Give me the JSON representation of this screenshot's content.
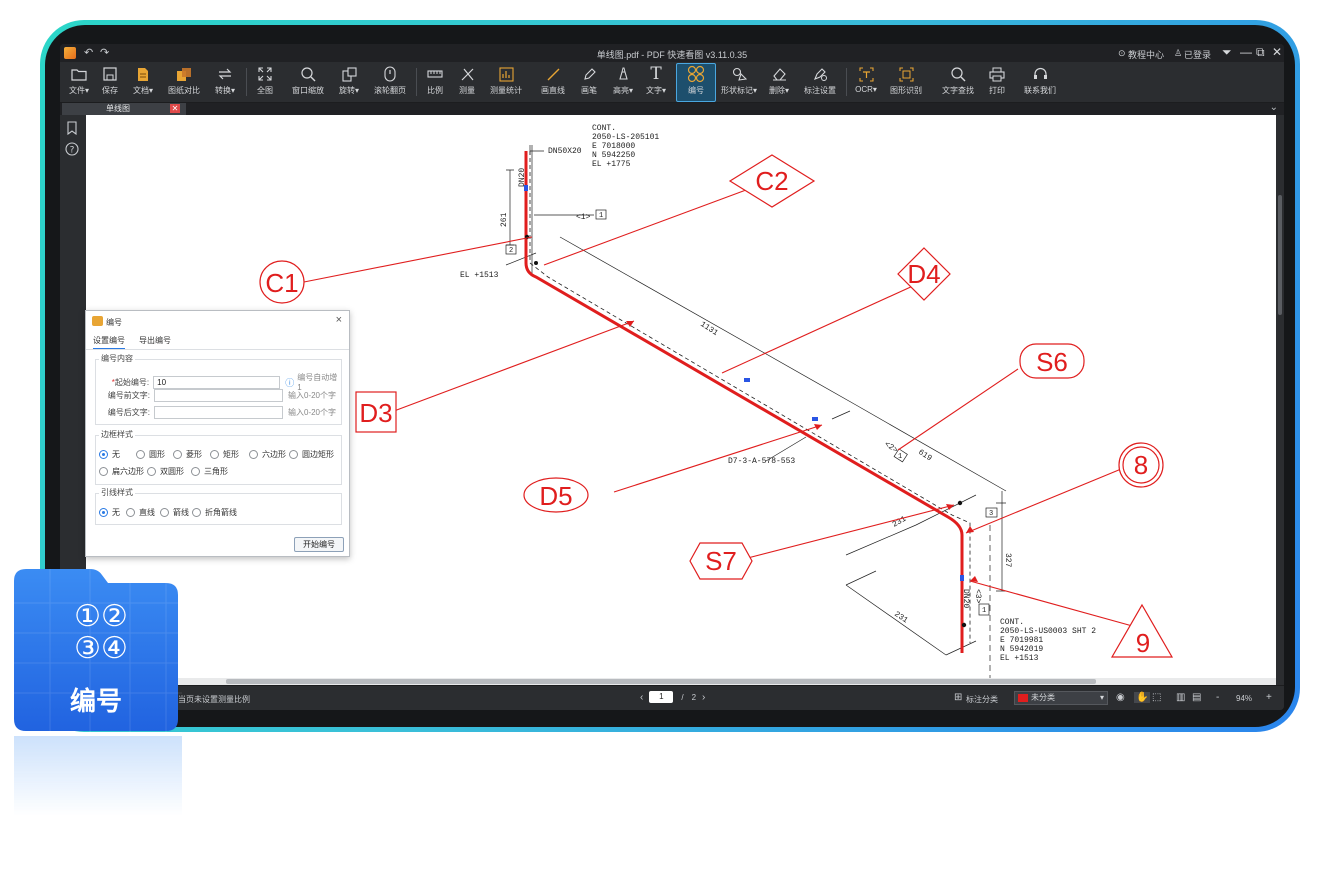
{
  "window": {
    "title": "单线图.pdf - PDF 快速看图 v3.11.0.35",
    "help_center": "教程中心",
    "login_status": "已登录"
  },
  "toolbar": {
    "items": [
      {
        "icon": "folder-icon",
        "label": "文件▾"
      },
      {
        "icon": "save-icon",
        "label": "保存"
      },
      {
        "icon": "document-icon",
        "label": "文档▾"
      },
      {
        "icon": "compare-icon",
        "label": "图纸对比"
      },
      {
        "icon": "convert-icon",
        "label": "转换▾"
      },
      {
        "icon": "fit-all-icon",
        "label": "全图"
      },
      {
        "icon": "zoom-window-icon",
        "label": "窗口缩放"
      },
      {
        "icon": "rotate-icon",
        "label": "旋转▾"
      },
      {
        "icon": "scroll-page-icon",
        "label": "滚轮翻页"
      },
      {
        "icon": "ruler-icon",
        "label": "比例"
      },
      {
        "icon": "measure-icon",
        "label": "测量"
      },
      {
        "icon": "measure-stats-icon",
        "label": "测量统计"
      },
      {
        "icon": "line-icon",
        "label": "画直线"
      },
      {
        "icon": "pen-icon",
        "label": "画笔"
      },
      {
        "icon": "highlight-icon",
        "label": "高亮▾"
      },
      {
        "icon": "text-icon",
        "label": "文字▾"
      },
      {
        "icon": "numbering-icon",
        "label": "编号"
      },
      {
        "icon": "shape-mark-icon",
        "label": "形状标记▾"
      },
      {
        "icon": "eraser-icon",
        "label": "删除▾"
      },
      {
        "icon": "markup-settings-icon",
        "label": "标注设置"
      },
      {
        "icon": "ocr-icon",
        "label": "OCR▾"
      },
      {
        "icon": "shape-recognition-icon",
        "label": "图形识别"
      },
      {
        "icon": "text-search-icon",
        "label": "文字查找"
      },
      {
        "icon": "print-icon",
        "label": "打印"
      },
      {
        "icon": "support-icon",
        "label": "联系我们"
      }
    ]
  },
  "tab": {
    "title": "单线图",
    "close": "✕"
  },
  "drawing": {
    "cont_top": [
      "CONT.",
      "2050-LS-205101",
      "E 7018000",
      "N 5942250",
      "EL +1775"
    ],
    "cont_bottom": [
      "CONT.",
      "2050-LS-US0003 SHT 2",
      "E 7019981",
      "N 5942019",
      "EL +1513"
    ],
    "labels": {
      "dn50x20": "DN50X20",
      "dn20_top": "DN20",
      "dn20_bottom": "DN20",
      "dim_261": "261",
      "dim_1131": "1131",
      "dim_619": "619",
      "dim_231a": "231",
      "dim_231b": "231",
      "dim_327": "327",
      "el_1513": "EL +1513",
      "line_no": "D7-3-A-578-553",
      "ref1": "<1>",
      "ref2": "<2>",
      "ref3": "<3>",
      "box1a": "1",
      "box2": "2",
      "box1b": "1",
      "box3": "3",
      "box1c": "1"
    },
    "callouts": [
      {
        "id": "C1",
        "shape": "ellipse"
      },
      {
        "id": "C2",
        "shape": "diamond"
      },
      {
        "id": "D3",
        "shape": "square"
      },
      {
        "id": "D4",
        "shape": "diamond"
      },
      {
        "id": "D5",
        "shape": "ellipse"
      },
      {
        "id": "S6",
        "shape": "rounded-rect"
      },
      {
        "id": "S7",
        "shape": "hexagon"
      },
      {
        "id": "8",
        "shape": "double-circle"
      },
      {
        "id": "9",
        "shape": "triangle"
      }
    ]
  },
  "dialog": {
    "title": "编号",
    "close": "×",
    "tabs": [
      "设置编号",
      "导出编号"
    ],
    "content_group": "编号内容",
    "start_label": "起始编号:",
    "start_required": "*",
    "start_value": "10",
    "auto_hint": "编号自动增1",
    "prefix_label": "编号前文字:",
    "prefix_hint": "输入0-20个字",
    "suffix_label": "编号后文字:",
    "suffix_hint": "输入0-20个字",
    "border_group": "边框样式",
    "border_options": [
      "无",
      "圆形",
      "菱形",
      "矩形",
      "六边形",
      "圆边矩形",
      "扁六边形",
      "双圆形",
      "三角形"
    ],
    "border_selected": "无",
    "leader_group": "引线样式",
    "leader_options": [
      "无",
      "直线",
      "箭线",
      "折角箭线"
    ],
    "leader_selected": "无",
    "start_button": "开始编号"
  },
  "statusbar": {
    "scale_note": "当页未设置测量比例",
    "page_current": "1",
    "page_sep": "/",
    "page_total": "2",
    "category_label": "标注分类",
    "category_value": "未分类",
    "zoom_minus": "-",
    "zoom": "94%",
    "zoom_plus": "+"
  },
  "badge": {
    "numbers": [
      "①",
      "②",
      "③",
      "④"
    ],
    "label": "编号"
  },
  "colors": {
    "frame_gradient_start": "#2bd6c8",
    "frame_gradient_end": "#2a84ec",
    "accent_red": "#e01e1e",
    "app_bg": "#2b2d30",
    "active_tool": "#4aa7e0",
    "badge_blue": "#2a7ae4"
  }
}
